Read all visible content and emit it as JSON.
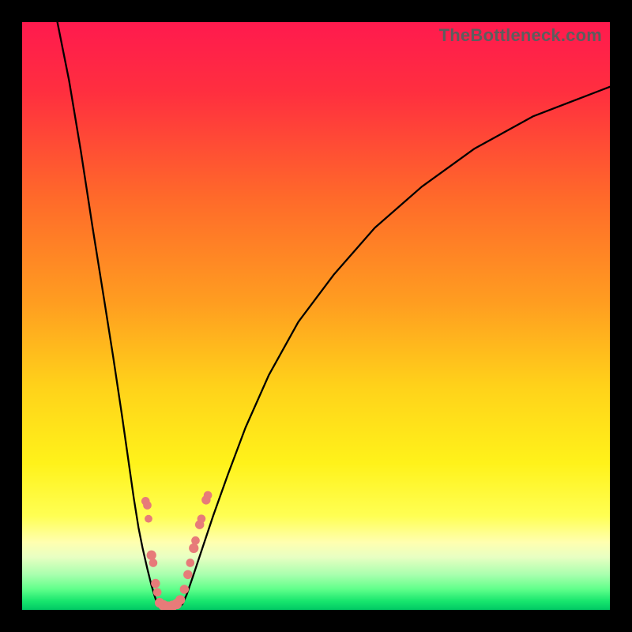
{
  "watermark": "TheBottleneck.com",
  "colors": {
    "gradient_stops": [
      {
        "pos": 0.0,
        "color": "#ff1a4e"
      },
      {
        "pos": 0.12,
        "color": "#ff2f3f"
      },
      {
        "pos": 0.3,
        "color": "#ff6a2a"
      },
      {
        "pos": 0.48,
        "color": "#ff9e20"
      },
      {
        "pos": 0.62,
        "color": "#ffd21a"
      },
      {
        "pos": 0.75,
        "color": "#fff21a"
      },
      {
        "pos": 0.84,
        "color": "#ffff53"
      },
      {
        "pos": 0.885,
        "color": "#ffffb0"
      },
      {
        "pos": 0.91,
        "color": "#e8ffc2"
      },
      {
        "pos": 0.94,
        "color": "#a9ffae"
      },
      {
        "pos": 0.965,
        "color": "#5fff8a"
      },
      {
        "pos": 0.985,
        "color": "#18e66e"
      },
      {
        "pos": 1.0,
        "color": "#00c864"
      }
    ],
    "curve": "#000000",
    "markers": "#e77b79"
  },
  "chart_data": {
    "type": "line",
    "title": "",
    "xlabel": "",
    "ylabel": "",
    "xlim": [
      0,
      100
    ],
    "ylim": [
      0,
      100
    ],
    "series": [
      {
        "name": "left-branch",
        "x": [
          6,
          8,
          10,
          12,
          14,
          15.5,
          17,
          18,
          19,
          19.8,
          20.5,
          21.3,
          22,
          22.6,
          23
        ],
        "y": [
          100,
          90,
          78,
          65,
          52.5,
          43,
          33,
          26,
          19,
          14,
          10.5,
          7,
          4.2,
          2.2,
          1.0
        ]
      },
      {
        "name": "valley",
        "x": [
          23,
          23.6,
          24.2,
          25,
          25.8,
          26.6,
          27.3
        ],
        "y": [
          1.0,
          0.4,
          0.15,
          0.05,
          0.15,
          0.4,
          1.0
        ]
      },
      {
        "name": "right-branch",
        "x": [
          27.3,
          28,
          29,
          30.5,
          32.5,
          35,
          38,
          42,
          47,
          53,
          60,
          68,
          77,
          87,
          100
        ],
        "y": [
          1.0,
          2.6,
          5.5,
          10,
          16,
          23,
          31,
          40,
          49,
          57,
          65,
          72,
          78.5,
          84,
          89
        ]
      }
    ],
    "markers": [
      {
        "x": 21.0,
        "y": 18.5,
        "r": 1.3
      },
      {
        "x": 21.3,
        "y": 17.8,
        "r": 1.3
      },
      {
        "x": 21.5,
        "y": 15.5,
        "r": 1.2
      },
      {
        "x": 22.0,
        "y": 9.3,
        "r": 1.5
      },
      {
        "x": 22.3,
        "y": 8.0,
        "r": 1.3
      },
      {
        "x": 22.7,
        "y": 4.5,
        "r": 1.4
      },
      {
        "x": 23.0,
        "y": 3.0,
        "r": 1.3
      },
      {
        "x": 23.4,
        "y": 1.2,
        "r": 1.5
      },
      {
        "x": 24.0,
        "y": 0.8,
        "r": 1.6
      },
      {
        "x": 24.8,
        "y": 0.55,
        "r": 1.6
      },
      {
        "x": 25.6,
        "y": 0.7,
        "r": 1.6
      },
      {
        "x": 26.3,
        "y": 1.0,
        "r": 1.6
      },
      {
        "x": 26.9,
        "y": 1.7,
        "r": 1.5
      },
      {
        "x": 27.6,
        "y": 3.5,
        "r": 1.4
      },
      {
        "x": 28.2,
        "y": 6.0,
        "r": 1.4
      },
      {
        "x": 28.6,
        "y": 8.0,
        "r": 1.3
      },
      {
        "x": 29.2,
        "y": 10.5,
        "r": 1.5
      },
      {
        "x": 29.5,
        "y": 11.8,
        "r": 1.3
      },
      {
        "x": 30.2,
        "y": 14.5,
        "r": 1.4
      },
      {
        "x": 30.5,
        "y": 15.5,
        "r": 1.3
      },
      {
        "x": 31.3,
        "y": 18.7,
        "r": 1.4
      },
      {
        "x": 31.6,
        "y": 19.5,
        "r": 1.3
      }
    ]
  }
}
